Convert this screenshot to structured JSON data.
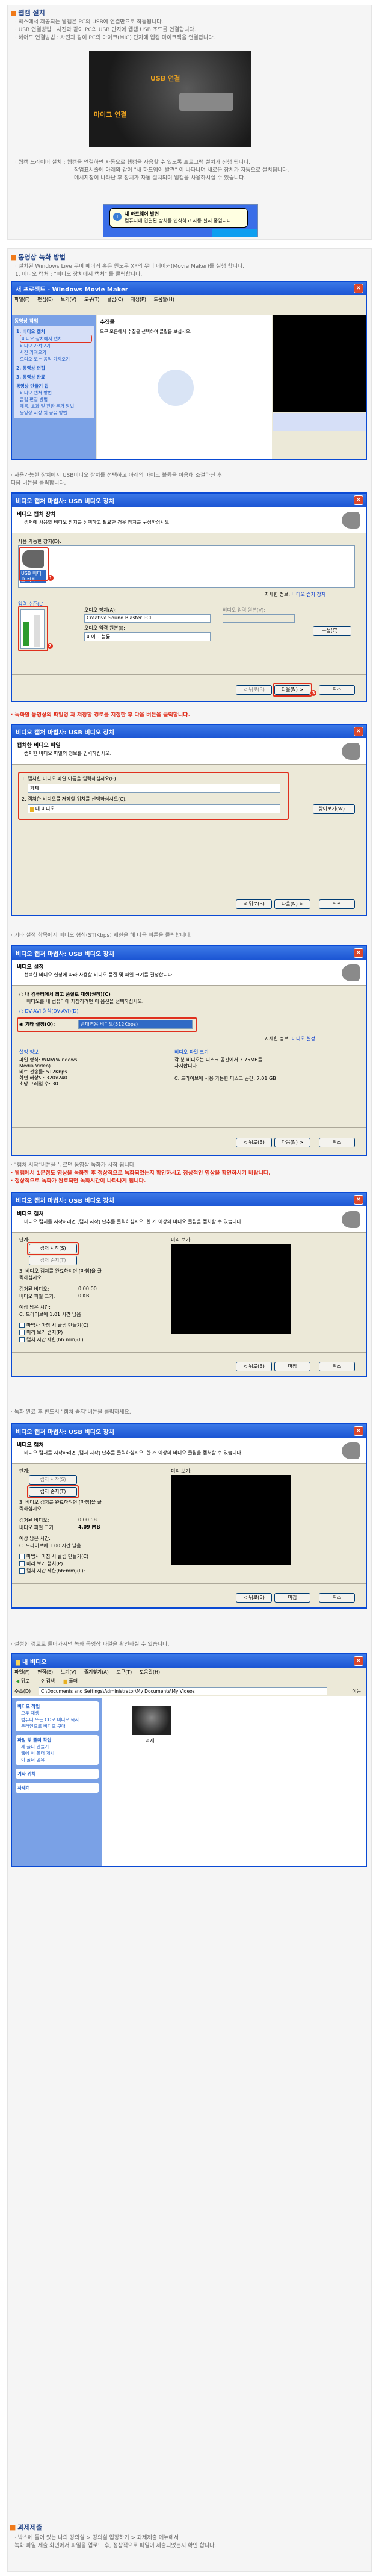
{
  "sections": {
    "s1": {
      "title": "웹캠 설치",
      "lines": [
        "· 박스에서 제공되는 웹캠은 PC의 USB에 연결만으로 작동됩니다.",
        "· USB 연결방법 : 사진과 같이 PC의 USB 단자에 웹캠 USB 조드를 연결합니다.",
        "· 헤어드 연결방법 : 사진과 같이 PC의 마이크(MIC) 단자에 웹캠 마이크잭을 연결합니다."
      ]
    },
    "s1b": {
      "lines": [
        "· 웹캠 드라이버 설치 : 웹캠을 연결하면 자동으로 웹캠을 사용할 수 있도록 프로그램 설치가 진행 됩니다.",
        "작업표시줄에 아래와 같이 \"새 하드웨어 발견\" 이 나타나며 새로운 장치가 자동으로 설치됩니다.",
        "메시지창이 나타난 후 장치가 자동 설치되며 웹캠을 사용하시실 수 있습니다."
      ]
    },
    "s2": {
      "title": "동영상 녹화 방법",
      "lines": [
        "· 설치된 Windows Live 무비 메이커 혹은 윈도우 XP의 무비 메이커(Movie Maker)를 실행 합니다.",
        "1. 비디오 캡처 : \"비디오 장치에서 캡처\" 를 클릭합니다."
      ]
    },
    "s3": {
      "lines": [
        "· 사용가능한 장치에서 USB비디오 장치를 선택하고 아래의 마이크 볼륨을 이용해 조절하신 후",
        "  다음 버튼을 클릭합니다."
      ]
    },
    "s4": {
      "red_line": "· 녹화할 동영상의 파일명 과 저장할 경로를 지정한 후 다음 버튼을 클릭합니다."
    },
    "s5": {
      "line": "· 기타 설정 항목에서 비디오 형식(STIKbps) 제한을 해 다음 버튼을 클릭합니다."
    },
    "s6": {
      "lines": [
        "· \"캡처 시작\"버튼을 누르면 동영상 녹화가 시작 됩니다."
      ],
      "red_lines": [
        "· 웹캠에서 1분정도 영상을 녹화한 후 정상적으로 녹화되었는지 확인하시고 정상적인 영상을 확인하시기 바랍니다.",
        "· 정상적으로 녹화가 완료되면 녹화시간이 나타나게 됩니다."
      ]
    },
    "s7": {
      "line": "· 녹화 완료 후 반드시 \"캡처 중지\"버튼을 클릭하세요."
    },
    "s8": {
      "line": "· 설정한 경로로 들어가시면 녹화 동영상 파일을 확인하실 수 있습니다."
    },
    "s9": {
      "title": "과제제출",
      "lines": [
        "· 박스에 들어 있는 나의 강의실 > 강의실 입장하기 > 과제제출 메뉴에서",
        "  녹화 파일 제출 화면에서 파일을 업로드 후, 정상적으로 파일이 제출되었는지 확인 합니다."
      ]
    }
  },
  "usb_photo": {
    "label_usb": "USB 연결",
    "label_mic": "마이크 연결"
  },
  "balloon": {
    "title": "새 하드웨어 발견",
    "body": "컴퓨터에 연결된 장치를 인식하고 자동 실치 중입니다."
  },
  "moviemaker": {
    "title": "새 프로젝트 - Windows Movie Maker",
    "menu": [
      "파일(F)",
      "편집(E)",
      "보기(V)",
      "도구(T)",
      "클립(C)",
      "재생(P)",
      "도움말(H)"
    ],
    "task_header": "동영상 작업",
    "collection_title": "수집물",
    "collection_sub": "도구 모음에서 수집을 선택하여 클립을 보십시오.",
    "tasks": [
      {
        "head": "1. 비디오 캡처",
        "items": [
          "비디오 장치에서 캡처",
          "비디오 가져오기",
          "사진 가져오기",
          "오디오 또는 음악 가져오기"
        ]
      },
      {
        "head": "2. 동영상 편집",
        "items": []
      },
      {
        "head": "3. 동영상 완료",
        "items": []
      },
      {
        "head": "동영상 만들기 팁",
        "items": [
          "비디오 캡처 방법",
          "클립 편집 방법",
          "제목, 효과 및 전환 추가 방법",
          "동영상 저장 및 공유 방법"
        ]
      }
    ]
  },
  "wiz1": {
    "title": "비디오 캡처 마법사: USB 비디오 장치",
    "h1": "비디오 캡처 장치",
    "h2": "캡처에 사용할 비디오 장치를 선택하고 필요한 경우 장치를 구성하십시오.",
    "devices_label": "사용 가능한 장치(D):",
    "device_name": "USB 비디오 장치",
    "help_text": "자세한 정보:",
    "help_link": "비디오 캡처 장치",
    "audio_group": "입력 수준(L)",
    "audio_device_label": "오디오 장치(A):",
    "audio_device": "Creative Sound Blaster PCI",
    "audio_input_label": "오디오 입력 원본(I):",
    "audio_input": "마이크 볼륨",
    "video_input_label": "비디오 입력 원본(V):",
    "configure": "구성(C)...",
    "back": "< 뒤로(B)",
    "next": "다음(N) >",
    "cancel": "취소"
  },
  "wiz2": {
    "title": "비디오 캡처 마법사: USB 비디오 장치",
    "h1": "캡처한 비디오 파일",
    "h2": "캡처한 비디오 파일의 정보를 입력하십시오.",
    "name_label": "1. 캡처한 비디오 파일 이름을 입력하십시오(E).",
    "name_value": "과제",
    "folder_label": "2. 캡처한 비디오를 저장할 위치를 선택하십시오(C).",
    "folder_value": "내 비디오",
    "browse": "찾아보기(W)...",
    "back": "< 뒤로(B)",
    "next": "다음(N) >",
    "cancel": "취소"
  },
  "wiz3": {
    "title": "비디오 캡처 마법사: USB 비디오 장치",
    "h1": "비디오 설정",
    "h2": "선택한 비디오 설정에 따라 사용할 비디오 품질 및 파일 크기를 결정합니다.",
    "opt1": "내 컴퓨터에서 최고 품질로 재생(권장)(C)",
    "opt1_sub": "비디오를 내 컴퓨터에 저장하려면 이 옵션을 선택하십시오.",
    "opt2": "DV-AVI 형식(DV-AVI)(D)",
    "opt3": "기타 설정(O):",
    "opt3_value": "광대역용 비디오(512Kbps)",
    "help_text": "자세한 정보:",
    "help_link": "비디오 설정",
    "setting_details_label": "설정 정보",
    "setting_details": [
      "파일 형식: WMV(Windows",
      "Media Video)",
      "비트 전송률: 512Kbps",
      "화면 해상도: 320x240",
      "초당 프레임 수: 30"
    ],
    "file_size_label": "비디오 파일 크기",
    "file_size_text": [
      "각 분 비디오는 디스크 공간에서 3.75MB를",
      "차지합니다."
    ],
    "disk_label": "C: 드라이브에 사용 가능한 디스크 공간: 7.01 GB",
    "back": "< 뒤로(B)",
    "next": "다음(N) >",
    "cancel": "취소"
  },
  "wiz4": {
    "title": "비디오 캡처 마법사: USB 비디오 장치",
    "h1": "비디오 캡처",
    "h2": "비디오 캡처를 시작하려면 [캡처 시작] 단추를 클릭하십시오. 한 개 이상의 비디오 클립을 캡처할 수 있습니다.",
    "steps_label": "단계:",
    "start": "캡처 시작(S)",
    "stop": "캡처 중지(T)",
    "step3": "3. 비디오 캡처를 완료하려면 [마침]을 클릭하십시오.",
    "preview_label": "미리 보기:",
    "captured_label": "캡처된 비디오:",
    "captured_value": "0:00:00",
    "size_label": "비디오 파일 크기:",
    "size_value": "0 KB",
    "remaining_label": "예상 남은 시간:",
    "remaining_value": "C: 드라이브에 1:01 시간 남음",
    "chk1": "마법사 마침 시 클립 만들기(C)",
    "chk2": "미리 보기 캡처(P)",
    "chk3": "캡처 시간 제한(hh:mm)(L):",
    "back": "< 뒤로(B)",
    "finish": "마침",
    "cancel": "취소"
  },
  "wiz5": {
    "captured_value": "0:00:58",
    "size_value": "4.09 MB",
    "remaining_value": "C: 드라이브에 1:00 시간 남음"
  },
  "explorer": {
    "title": "내 비디오",
    "menu": [
      "파일(F)",
      "편집(E)",
      "보기(V)",
      "즐겨찾기(A)",
      "도구(T)",
      "도움말(H)"
    ],
    "back": "뒤로",
    "search": "검색",
    "folders": "폴더",
    "address_label": "주소(D)",
    "address": "C:\\Documents and Settings\\Administrator\\My Documents\\My Videos",
    "go": "이동",
    "task1": "비디오 작업",
    "task1_items": [
      "모두 재생",
      "컴퓨터 또는 CD로 비디오 복사",
      "온라인으로 비디오 구매"
    ],
    "task2": "파일 및 폴더 작업",
    "task2_items": [
      "새 폴더 만들기",
      "웹에 이 폴더 게시",
      "이 폴더 공유"
    ],
    "task3": "기타 위치",
    "task4": "자세히",
    "file_name": "과제"
  }
}
